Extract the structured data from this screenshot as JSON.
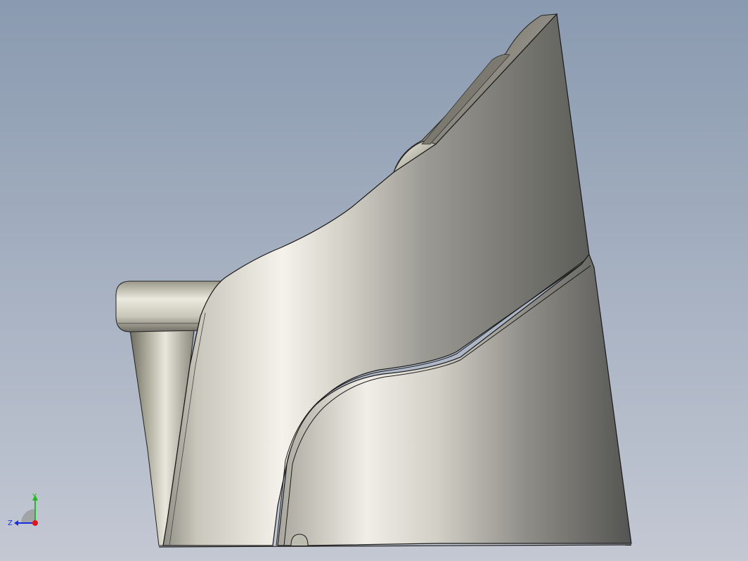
{
  "triad": {
    "x_label": "",
    "y_label": "Y",
    "z_label": "Z",
    "x_color": "#e0141b",
    "y_color": "#1dbb1d",
    "z_color": "#1a2ee0"
  },
  "colors": {
    "background_top": "#8a9ab0",
    "background_bottom": "#c3c8d3",
    "part_light": "#f2f0e6",
    "part_mid": "#b5b3a8",
    "part_dark": "#5a5a56",
    "edge": "#1a1a1a"
  }
}
